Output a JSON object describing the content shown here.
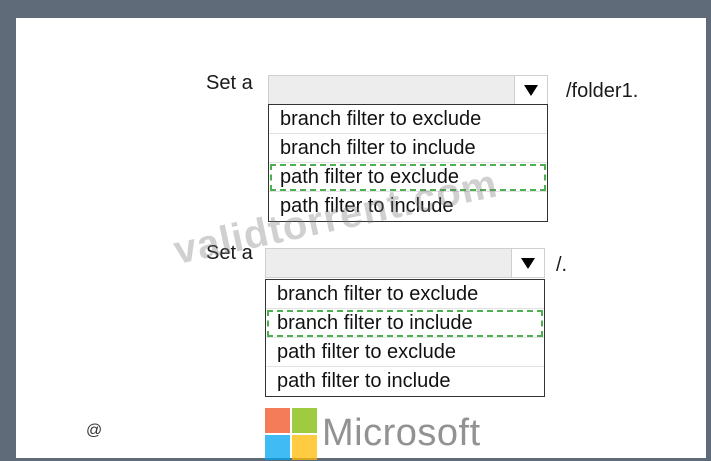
{
  "dropdown1": {
    "label": "Set a",
    "suffix": "/folder1.",
    "options": [
      {
        "label": "branch filter to exclude",
        "selected": false
      },
      {
        "label": "branch filter to include",
        "selected": false
      },
      {
        "label": "path filter to exclude",
        "selected": true
      },
      {
        "label": "path filter to include",
        "selected": false
      }
    ]
  },
  "dropdown2": {
    "label": "Set a",
    "suffix": "/.",
    "options": [
      {
        "label": "branch filter to exclude",
        "selected": false
      },
      {
        "label": "branch filter to include",
        "selected": true
      },
      {
        "label": "path filter to exclude",
        "selected": false
      },
      {
        "label": "path filter to include",
        "selected": false
      }
    ]
  },
  "watermark": "validtorrent.com",
  "footer": {
    "at_symbol": "@",
    "brand": "Microsoft"
  },
  "colors": {
    "selection_outline": "#4caf50",
    "logo_red": "#f25022",
    "logo_green": "#7fba00",
    "logo_blue": "#00a4ef",
    "logo_yellow": "#ffb900"
  }
}
